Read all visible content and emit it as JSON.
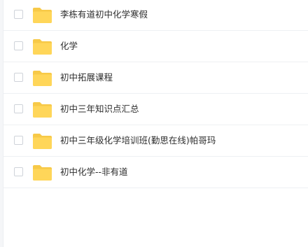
{
  "files": [
    {
      "name": "李栋有道初中化学寒假",
      "icon": "folder-icon",
      "checked": false
    },
    {
      "name": "化学",
      "icon": "folder-icon",
      "checked": false
    },
    {
      "name": "初中拓展课程",
      "icon": "folder-icon",
      "checked": false
    },
    {
      "name": "初中三年知识点汇总",
      "icon": "folder-icon",
      "checked": false
    },
    {
      "name": "初中三年级化学培训班(勤思在线)帕哥玛",
      "icon": "folder-icon",
      "checked": false
    },
    {
      "name": "初中化学--非有道",
      "icon": "folder-icon",
      "checked": false
    }
  ],
  "colors": {
    "folder_back": "#f7c948",
    "folder_front": "#ffd659",
    "row_border": "#eef0f3"
  }
}
